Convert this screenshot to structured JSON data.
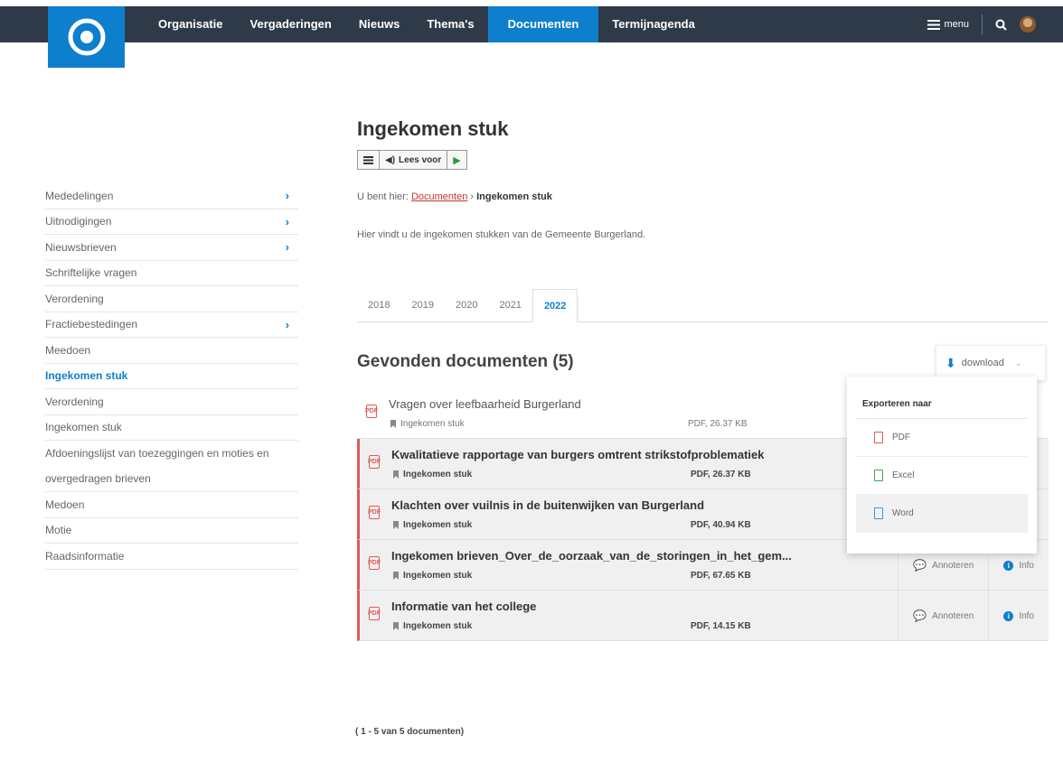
{
  "nav": {
    "items": [
      {
        "label": "Organisatie",
        "active": false
      },
      {
        "label": "Vergaderingen",
        "active": false
      },
      {
        "label": "Nieuws",
        "active": false
      },
      {
        "label": "Thema's",
        "active": false
      },
      {
        "label": "Documenten",
        "active": true
      },
      {
        "label": "Termijnagenda",
        "active": false
      }
    ],
    "menu_label": "menu",
    "search_icon": "search-icon",
    "avatar_icon": "user-avatar"
  },
  "sidebar": {
    "items": [
      {
        "label": "Mededelingen",
        "has_children": true
      },
      {
        "label": "Uitnodigingen",
        "has_children": true
      },
      {
        "label": "Nieuwsbrieven",
        "has_children": true
      },
      {
        "label": "Schriftelijke vragen",
        "has_children": false
      },
      {
        "label": "Verordening",
        "has_children": false
      },
      {
        "label": "Fractiebestedingen",
        "has_children": true
      },
      {
        "label": "Meedoen",
        "has_children": false
      },
      {
        "label": "Ingekomen stuk",
        "has_children": false,
        "active": true
      },
      {
        "label": "Verordening",
        "has_children": false
      },
      {
        "label": "Ingekomen stuk",
        "has_children": false
      },
      {
        "label": "Afdoeningslijst van toezeggingen en moties en overgedragen brieven",
        "has_children": false,
        "multiline": true
      },
      {
        "label": "Medoen",
        "has_children": false
      },
      {
        "label": "Motie",
        "has_children": false
      },
      {
        "label": "Raadsinformatie",
        "has_children": false
      }
    ]
  },
  "page": {
    "title": "Ingekomen stuk",
    "readbar": {
      "read_label": "Lees voor"
    },
    "breadcrumb": {
      "prefix": "U bent hier:",
      "link": "Documenten",
      "separator": "›",
      "current": "Ingekomen stuk"
    },
    "intro": "Hier vindt u de ingekomen stukken van de Gemeente Burgerland."
  },
  "tabs": [
    {
      "label": "2018",
      "active": false
    },
    {
      "label": "2019",
      "active": false
    },
    {
      "label": "2020",
      "active": false
    },
    {
      "label": "2021",
      "active": false
    },
    {
      "label": "2022",
      "active": true
    }
  ],
  "results": {
    "title": "Gevonden documenten (5)",
    "download_label": "download",
    "export": {
      "title": "Exporteren naar",
      "options": [
        {
          "label": "PDF",
          "color": "#e05a5a"
        },
        {
          "label": "Excel",
          "color": "#3aa655"
        },
        {
          "label": "Word",
          "color": "#4a90d9"
        }
      ]
    },
    "documents": [
      {
        "title": "Vragen over leefbaarheid Burgerland",
        "type": "Ingekomen stuk",
        "size": "PDF, 26.37 KB",
        "highlight": false,
        "actions": false
      },
      {
        "title": "Kwalitatieve rapportage van burgers omtrent strikstofproblematiek",
        "type": "Ingekomen stuk",
        "size": "PDF, 26.37 KB",
        "highlight": true,
        "actions": false
      },
      {
        "title": "Klachten over vuilnis in de buitenwijken van Burgerland",
        "type": "Ingekomen stuk",
        "size": "PDF, 40.94 KB",
        "highlight": true,
        "actions": false
      },
      {
        "title": "Ingekomen brieven_Over_de_oorzaak_van_de_storingen_in_het_gem...",
        "type": "Ingekomen stuk",
        "size": "PDF, 67.65 KB",
        "highlight": true,
        "actions": true
      },
      {
        "title": "Informatie van het college",
        "type": "Ingekomen stuk",
        "size": "PDF, 14.15 KB",
        "highlight": true,
        "actions": true
      }
    ],
    "action_labels": {
      "annotate": "Annoteren",
      "info": "Info"
    },
    "pager": "( 1 - 5 van 5 documenten)"
  },
  "colors": {
    "brand": "#0e7fcd",
    "topbar": "#2f3a48",
    "pdf": "#e05a5a"
  }
}
